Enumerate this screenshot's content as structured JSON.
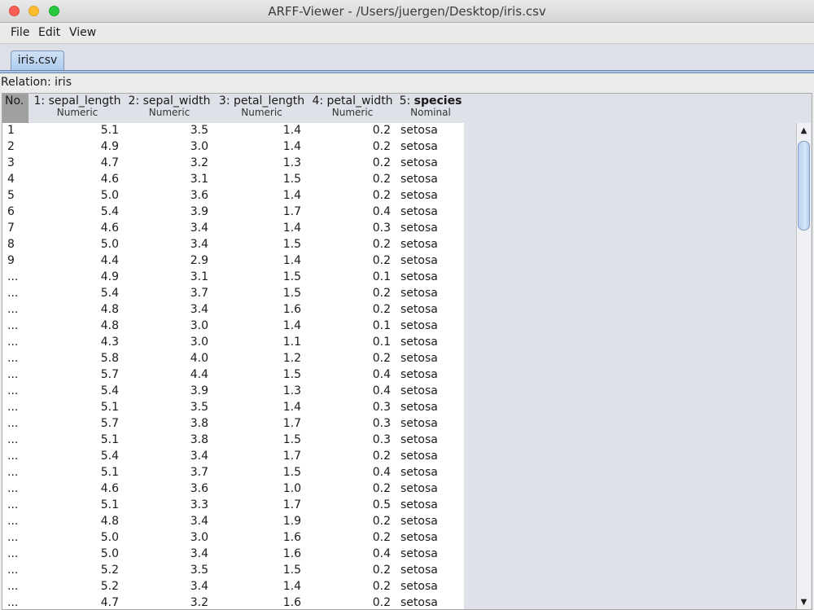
{
  "window": {
    "title": "ARFF-Viewer - /Users/juergen/Desktop/iris.csv"
  },
  "menu": {
    "file": "File",
    "edit": "Edit",
    "view": "View"
  },
  "tab": {
    "label": "iris.csv"
  },
  "relation": "Relation: iris",
  "table": {
    "no_header": "No.",
    "columns": [
      {
        "name": "1: sepal_length",
        "type": "Numeric"
      },
      {
        "name": "2: sepal_width",
        "type": "Numeric"
      },
      {
        "name": "3: petal_length",
        "type": "Numeric"
      },
      {
        "name": "4: petal_width",
        "type": "Numeric"
      },
      {
        "prefix": "5: ",
        "name": "species",
        "type": "Nominal"
      }
    ],
    "rows": [
      [
        "1",
        "5.1",
        "3.5",
        "1.4",
        "0.2",
        "setosa"
      ],
      [
        "2",
        "4.9",
        "3.0",
        "1.4",
        "0.2",
        "setosa"
      ],
      [
        "3",
        "4.7",
        "3.2",
        "1.3",
        "0.2",
        "setosa"
      ],
      [
        "4",
        "4.6",
        "3.1",
        "1.5",
        "0.2",
        "setosa"
      ],
      [
        "5",
        "5.0",
        "3.6",
        "1.4",
        "0.2",
        "setosa"
      ],
      [
        "6",
        "5.4",
        "3.9",
        "1.7",
        "0.4",
        "setosa"
      ],
      [
        "7",
        "4.6",
        "3.4",
        "1.4",
        "0.3",
        "setosa"
      ],
      [
        "8",
        "5.0",
        "3.4",
        "1.5",
        "0.2",
        "setosa"
      ],
      [
        "9",
        "4.4",
        "2.9",
        "1.4",
        "0.2",
        "setosa"
      ],
      [
        "...",
        "4.9",
        "3.1",
        "1.5",
        "0.1",
        "setosa"
      ],
      [
        "...",
        "5.4",
        "3.7",
        "1.5",
        "0.2",
        "setosa"
      ],
      [
        "...",
        "4.8",
        "3.4",
        "1.6",
        "0.2",
        "setosa"
      ],
      [
        "...",
        "4.8",
        "3.0",
        "1.4",
        "0.1",
        "setosa"
      ],
      [
        "...",
        "4.3",
        "3.0",
        "1.1",
        "0.1",
        "setosa"
      ],
      [
        "...",
        "5.8",
        "4.0",
        "1.2",
        "0.2",
        "setosa"
      ],
      [
        "...",
        "5.7",
        "4.4",
        "1.5",
        "0.4",
        "setosa"
      ],
      [
        "...",
        "5.4",
        "3.9",
        "1.3",
        "0.4",
        "setosa"
      ],
      [
        "...",
        "5.1",
        "3.5",
        "1.4",
        "0.3",
        "setosa"
      ],
      [
        "...",
        "5.7",
        "3.8",
        "1.7",
        "0.3",
        "setosa"
      ],
      [
        "...",
        "5.1",
        "3.8",
        "1.5",
        "0.3",
        "setosa"
      ],
      [
        "...",
        "5.4",
        "3.4",
        "1.7",
        "0.2",
        "setosa"
      ],
      [
        "...",
        "5.1",
        "3.7",
        "1.5",
        "0.4",
        "setosa"
      ],
      [
        "...",
        "4.6",
        "3.6",
        "1.0",
        "0.2",
        "setosa"
      ],
      [
        "...",
        "5.1",
        "3.3",
        "1.7",
        "0.5",
        "setosa"
      ],
      [
        "...",
        "4.8",
        "3.4",
        "1.9",
        "0.2",
        "setosa"
      ],
      [
        "...",
        "5.0",
        "3.0",
        "1.6",
        "0.2",
        "setosa"
      ],
      [
        "...",
        "5.0",
        "3.4",
        "1.6",
        "0.4",
        "setosa"
      ],
      [
        "...",
        "5.2",
        "3.5",
        "1.5",
        "0.2",
        "setosa"
      ],
      [
        "...",
        "5.2",
        "3.4",
        "1.4",
        "0.2",
        "setosa"
      ],
      [
        "...",
        "4.7",
        "3.2",
        "1.6",
        "0.2",
        "setosa"
      ]
    ]
  },
  "scrollbar": {
    "up": "▲",
    "down": "▼"
  },
  "colors": {
    "close": "#fc5f57",
    "minimize": "#fdbc2e",
    "maximize": "#28c840",
    "selected_tab": "#aecbee"
  }
}
